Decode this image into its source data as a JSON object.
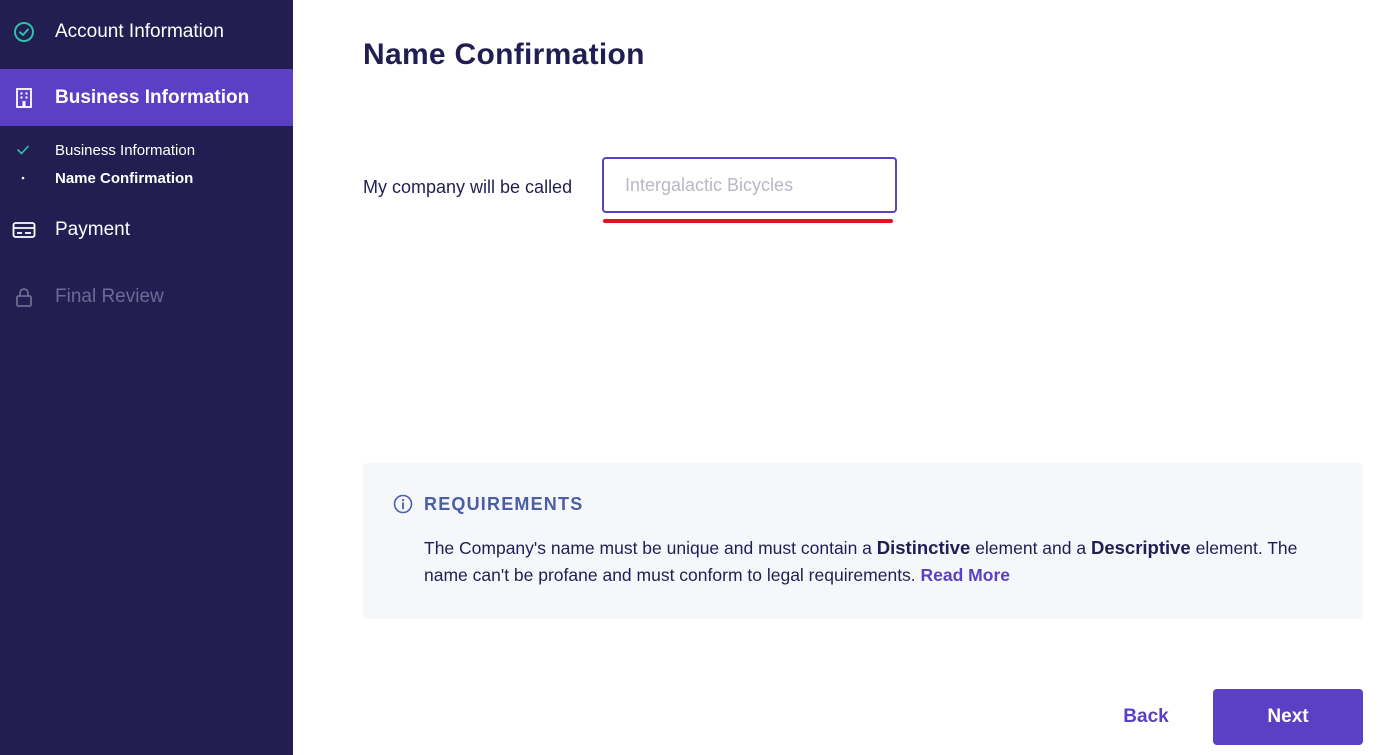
{
  "sidebar": {
    "items": [
      {
        "label": "Account Information",
        "icon": "check-circle-icon",
        "state": "completed"
      },
      {
        "label": "Business Information",
        "icon": "building-icon",
        "state": "active"
      },
      {
        "label": "Payment",
        "icon": "credit-card-icon",
        "state": "pending"
      },
      {
        "label": "Final Review",
        "icon": "lock-icon",
        "state": "locked"
      }
    ],
    "subitems": [
      {
        "label": "Business Information",
        "marker": "checkmark-icon"
      },
      {
        "label": "Name Confirmation",
        "marker": "dot-icon"
      }
    ]
  },
  "main": {
    "title": "Name Confirmation",
    "name_field": {
      "label": "My company will be called",
      "placeholder": "Intergalactic Bicycles",
      "value": ""
    },
    "requirements": {
      "title": "REQUIREMENTS",
      "text_part1": "The Company's name must be unique and must contain a ",
      "bold1": "Distinctive",
      "text_part2": " element and a ",
      "bold2": "Descriptive",
      "text_part3": " element. The name can't be profane and must conform to legal requirements. ",
      "link": "Read More"
    },
    "buttons": {
      "back": "Back",
      "next": "Next"
    }
  },
  "colors": {
    "sidebar_bg": "#221e52",
    "accent": "#5b3fc4",
    "error_underline": "#e8101e",
    "requirements_title": "#4a5ea8",
    "completed_check": "#2fbfa6"
  }
}
